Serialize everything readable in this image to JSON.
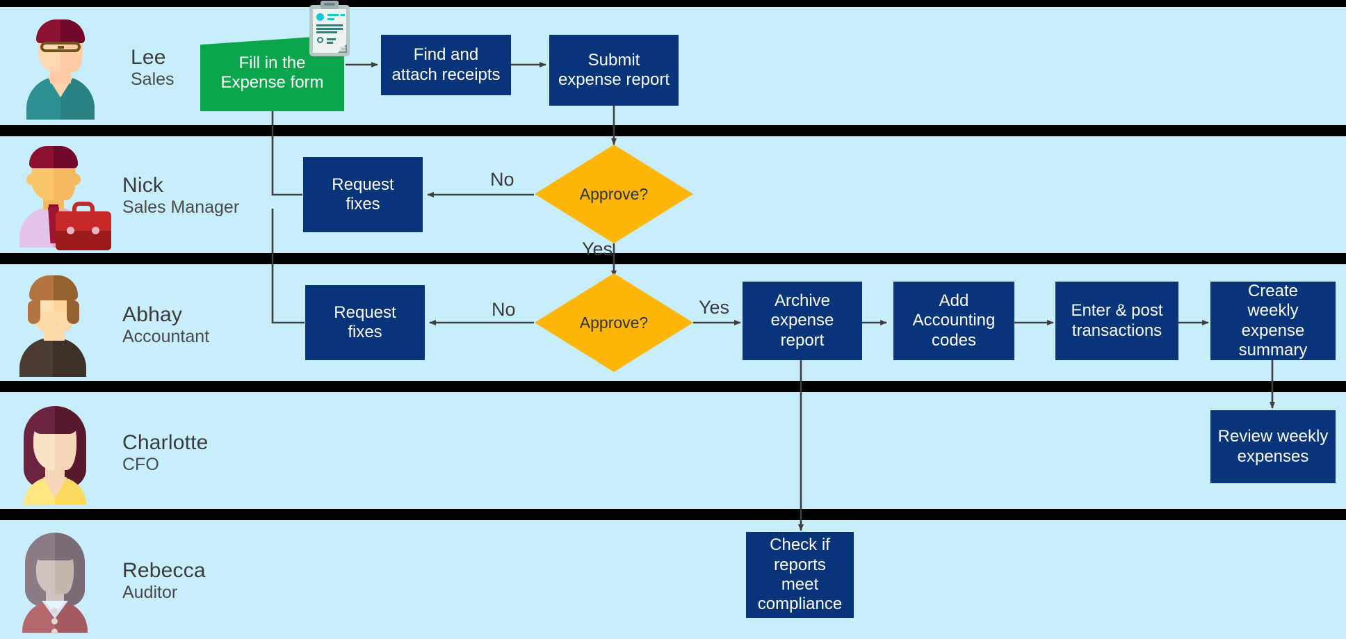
{
  "diagram": {
    "title": "Expense report approval swimlane process",
    "colors": {
      "lane_background": "#c8eefb",
      "lane_divider": "#000000",
      "process_box": "#083579",
      "start_box": "#0ba54b",
      "decision": "#ffb60a",
      "connector": "#3f3f3f",
      "box_text": "#ffffff",
      "label_text": "#3a3a3a"
    },
    "lanes": [
      {
        "id": "lane-lee",
        "actor": {
          "name": "Lee",
          "role": "Sales",
          "avatar_icon": "person-avatar-lee"
        },
        "nodes": [
          {
            "id": "fill-form",
            "label": "Fill in the\nExpense form",
            "type": "start",
            "icon": "clipboard-form-icon"
          },
          {
            "id": "attach-receipts",
            "label": "Find and\nattach receipts",
            "type": "process"
          },
          {
            "id": "submit-report",
            "label": "Submit\nexpense report",
            "type": "process"
          }
        ]
      },
      {
        "id": "lane-nick",
        "actor": {
          "name": "Nick",
          "role": "Sales Manager",
          "avatar_icon": "person-avatar-nick"
        },
        "nodes": [
          {
            "id": "mgr-request-fixes",
            "label": "Request\nfixes",
            "type": "process"
          },
          {
            "id": "mgr-approve",
            "label": "Approve?",
            "type": "decision"
          }
        ],
        "edge_labels": [
          "No",
          "Yes"
        ]
      },
      {
        "id": "lane-abhay",
        "actor": {
          "name": "Abhay",
          "role": "Accountant",
          "avatar_icon": "person-avatar-abhay"
        },
        "nodes": [
          {
            "id": "acct-request-fixes",
            "label": "Request\nfixes",
            "type": "process"
          },
          {
            "id": "acct-approve",
            "label": "Approve?",
            "type": "decision"
          },
          {
            "id": "archive-report",
            "label": "Archive\nexpense report",
            "type": "process"
          },
          {
            "id": "add-codes",
            "label": "Add\nAccounting\ncodes",
            "type": "process"
          },
          {
            "id": "post-transactions",
            "label": "Enter & post\ntransactions",
            "type": "process"
          },
          {
            "id": "weekly-summary",
            "label": "Create\nweekly expense\nsummary",
            "type": "process"
          }
        ],
        "edge_labels": [
          "No",
          "Yes"
        ]
      },
      {
        "id": "lane-charlotte",
        "actor": {
          "name": "Charlotte",
          "role": "CFO",
          "avatar_icon": "person-avatar-charlotte"
        },
        "nodes": [
          {
            "id": "review-weekly",
            "label": "Review weekly\nexpenses",
            "type": "process"
          }
        ]
      },
      {
        "id": "lane-rebecca",
        "actor": {
          "name": "Rebecca",
          "role": "Auditor",
          "avatar_icon": "person-avatar-rebecca"
        },
        "nodes": [
          {
            "id": "check-compliance",
            "label": "Check if\nreports\nmeet\ncompliance",
            "type": "process"
          }
        ]
      }
    ],
    "labels": {
      "lee_name": "Lee",
      "lee_role": "Sales",
      "nick_name": "Nick",
      "nick_role": "Sales Manager",
      "abhay_name": "Abhay",
      "abhay_role": "Accountant",
      "charlotte_name": "Charlotte",
      "charlotte_role": "CFO",
      "rebecca_name": "Rebecca",
      "rebecca_role": "Auditor",
      "fill_form_l1": "Fill in the",
      "fill_form_l2": "Expense form",
      "attach_l1": "Find and",
      "attach_l2": "attach receipts",
      "submit_l1": "Submit",
      "submit_l2": "expense report",
      "mgr_fixes_l1": "Request",
      "mgr_fixes_l2": "fixes",
      "mgr_decision": "Approve?",
      "mgr_no": "No",
      "mgr_yes": "Yes",
      "acct_fixes_l1": "Request",
      "acct_fixes_l2": "fixes",
      "acct_decision": "Approve?",
      "acct_no": "No",
      "acct_yes": "Yes",
      "archive_l1": "Archive",
      "archive_l2": "expense report",
      "codes_l1": "Add",
      "codes_l2": "Accounting",
      "codes_l3": "codes",
      "post_l1": "Enter & post",
      "post_l2": "transactions",
      "summary_l1": "Create",
      "summary_l2": "weekly expense",
      "summary_l3": "summary",
      "review_l1": "Review weekly",
      "review_l2": "expenses",
      "compliance_l1": "Check if",
      "compliance_l2": "reports",
      "compliance_l3": "meet",
      "compliance_l4": "compliance"
    }
  }
}
